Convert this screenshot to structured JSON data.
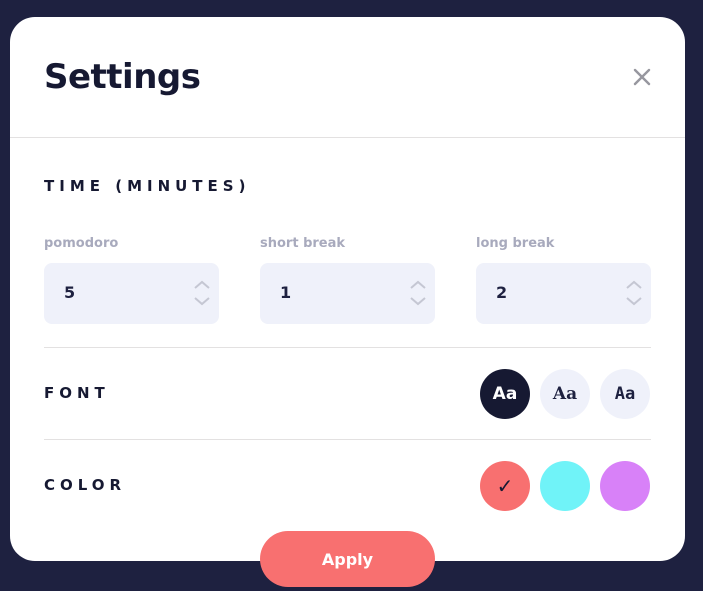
{
  "modal": {
    "title": "Settings"
  },
  "time": {
    "label": "TIME (MINUTES)",
    "fields": [
      {
        "label": "pomodoro",
        "value": "5"
      },
      {
        "label": "short break",
        "value": "1"
      },
      {
        "label": "long break",
        "value": "2"
      }
    ]
  },
  "font": {
    "label": "FONT",
    "options": [
      {
        "label": "Aa",
        "selected": true
      },
      {
        "label": "Aa",
        "selected": false
      },
      {
        "label": "Aa",
        "selected": false
      }
    ]
  },
  "color": {
    "label": "COLOR",
    "options": [
      {
        "hex": "#f87070",
        "selected": true,
        "mark": "✓"
      },
      {
        "hex": "#70f3f8",
        "selected": false
      },
      {
        "hex": "#d881f8",
        "selected": false
      }
    ]
  },
  "apply_label": "Apply"
}
